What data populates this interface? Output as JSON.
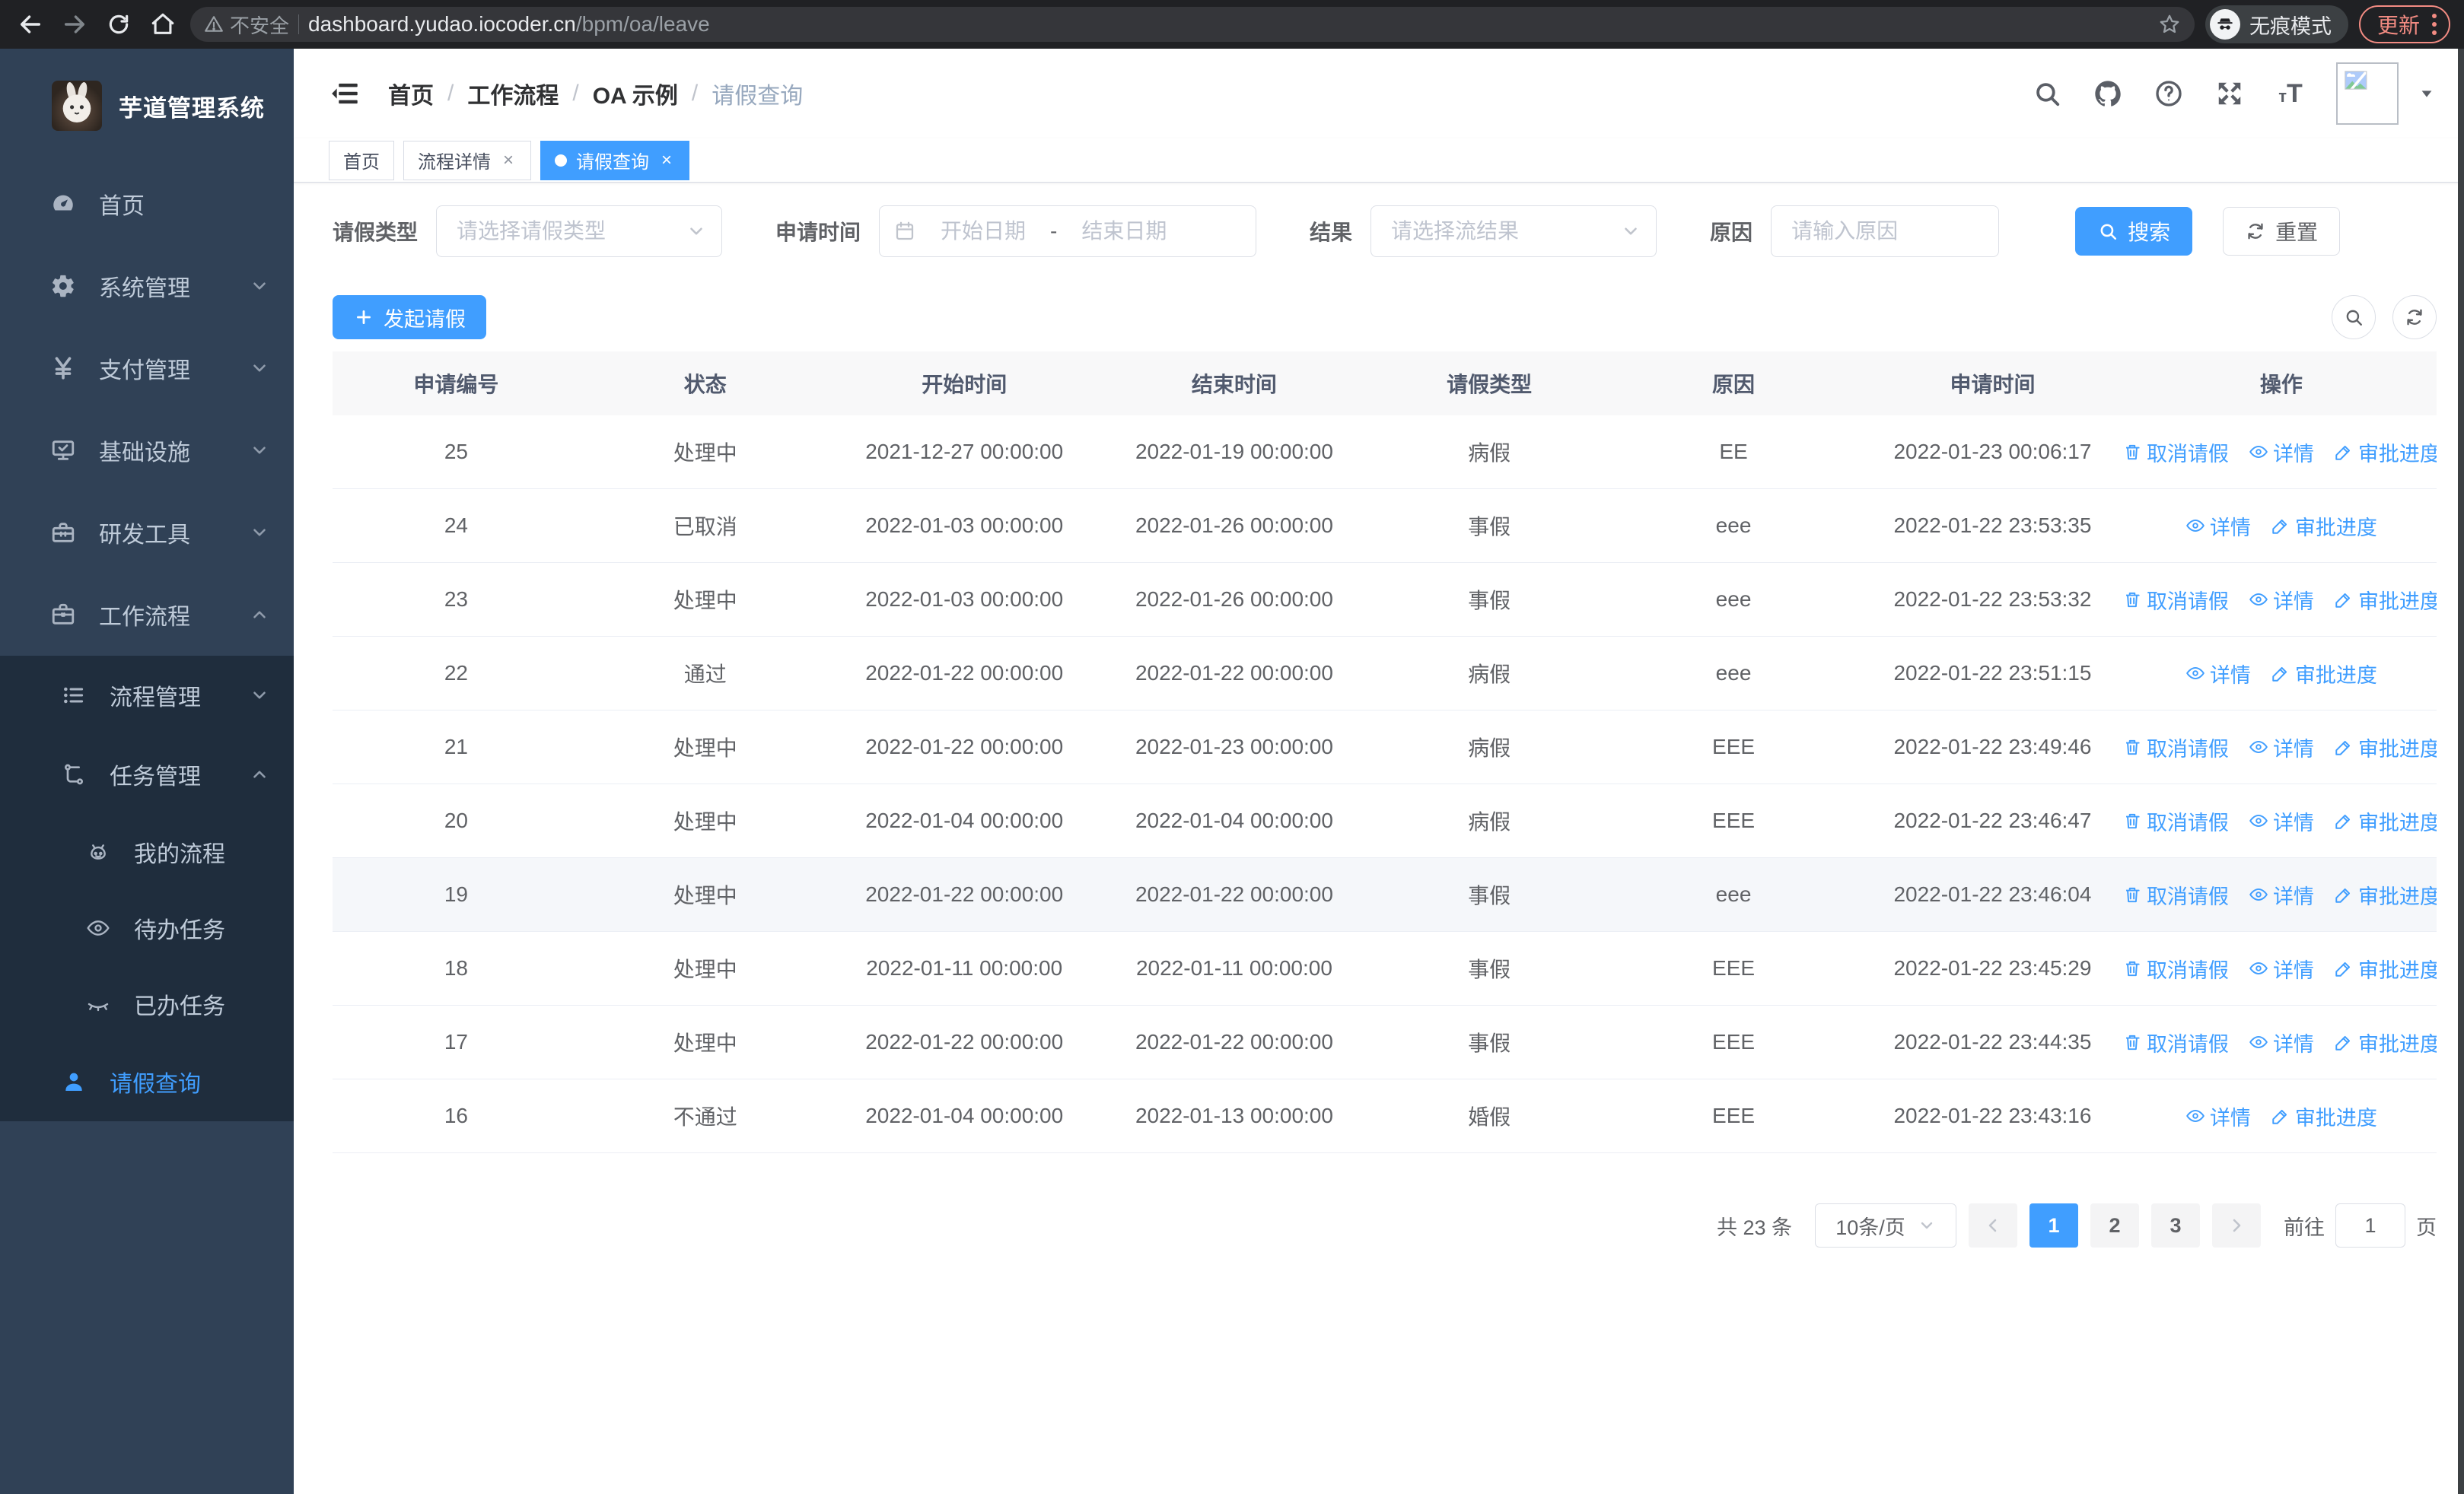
{
  "browser": {
    "security_label": "不安全",
    "url_host": "dashboard.yudao.iocoder.cn",
    "url_path": "/bpm/oa/leave",
    "incognito_label": "无痕模式",
    "update_label": "更新"
  },
  "sidebar": {
    "title": "芋道管理系统",
    "items": [
      {
        "label": "首页",
        "icon": "dashboard-icon"
      },
      {
        "label": "系统管理",
        "icon": "gear-icon",
        "chevron": "down"
      },
      {
        "label": "支付管理",
        "icon": "yen-icon",
        "chevron": "down"
      },
      {
        "label": "基础设施",
        "icon": "monitor-icon",
        "chevron": "down"
      },
      {
        "label": "研发工具",
        "icon": "toolbox-icon",
        "chevron": "down"
      },
      {
        "label": "工作流程",
        "icon": "briefcase-icon",
        "chevron": "up"
      },
      {
        "label": "流程管理",
        "icon": "list-icon",
        "chevron": "down"
      },
      {
        "label": "任务管理",
        "icon": "flow-icon",
        "chevron": "up"
      },
      {
        "label": "我的流程",
        "icon": "robot-icon"
      },
      {
        "label": "待办任务",
        "icon": "eye-icon"
      },
      {
        "label": "已办任务",
        "icon": "eye-closed-icon"
      },
      {
        "label": "请假查询",
        "icon": "user-icon",
        "active": true
      }
    ]
  },
  "breadcrumb": {
    "items": [
      "首页",
      "工作流程",
      "OA 示例",
      "请假查询"
    ]
  },
  "tabs": [
    {
      "label": "首页",
      "closable": false,
      "active": false
    },
    {
      "label": "流程详情",
      "closable": true,
      "active": false
    },
    {
      "label": "请假查询",
      "closable": true,
      "active": true
    }
  ],
  "filters": {
    "leave_type": {
      "label": "请假类型",
      "placeholder": "请选择请假类型"
    },
    "apply_time": {
      "label": "申请时间",
      "start_placeholder": "开始日期",
      "separator": "-",
      "end_placeholder": "结束日期"
    },
    "result": {
      "label": "结果",
      "placeholder": "请选择流结果"
    },
    "reason": {
      "label": "原因",
      "placeholder": "请输入原因"
    },
    "search_label": "搜索",
    "reset_label": "重置"
  },
  "toolbar": {
    "create_label": "发起请假"
  },
  "table": {
    "columns": [
      "申请编号",
      "状态",
      "开始时间",
      "结束时间",
      "请假类型",
      "原因",
      "申请时间",
      "操作"
    ],
    "action_labels": {
      "cancel": "取消请假",
      "detail": "详情",
      "progress": "审批进度"
    },
    "rows": [
      {
        "id": "25",
        "status": "处理中",
        "start_time": "2021-12-27 00:00:00",
        "end_time": "2022-01-19 00:00:00",
        "leave_type": "病假",
        "reason": "EE",
        "apply_time": "2022-01-23 00:06:17",
        "actions": [
          "cancel",
          "detail",
          "progress"
        ]
      },
      {
        "id": "24",
        "status": "已取消",
        "start_time": "2022-01-03 00:00:00",
        "end_time": "2022-01-26 00:00:00",
        "leave_type": "事假",
        "reason": "eee",
        "apply_time": "2022-01-22 23:53:35",
        "actions": [
          "detail",
          "progress"
        ]
      },
      {
        "id": "23",
        "status": "处理中",
        "start_time": "2022-01-03 00:00:00",
        "end_time": "2022-01-26 00:00:00",
        "leave_type": "事假",
        "reason": "eee",
        "apply_time": "2022-01-22 23:53:32",
        "actions": [
          "cancel",
          "detail",
          "progress"
        ]
      },
      {
        "id": "22",
        "status": "通过",
        "start_time": "2022-01-22 00:00:00",
        "end_time": "2022-01-22 00:00:00",
        "leave_type": "病假",
        "reason": "eee",
        "apply_time": "2022-01-22 23:51:15",
        "actions": [
          "detail",
          "progress"
        ]
      },
      {
        "id": "21",
        "status": "处理中",
        "start_time": "2022-01-22 00:00:00",
        "end_time": "2022-01-23 00:00:00",
        "leave_type": "病假",
        "reason": "EEE",
        "apply_time": "2022-01-22 23:49:46",
        "actions": [
          "cancel",
          "detail",
          "progress"
        ]
      },
      {
        "id": "20",
        "status": "处理中",
        "start_time": "2022-01-04 00:00:00",
        "end_time": "2022-01-04 00:00:00",
        "leave_type": "病假",
        "reason": "EEE",
        "apply_time": "2022-01-22 23:46:47",
        "actions": [
          "cancel",
          "detail",
          "progress"
        ]
      },
      {
        "id": "19",
        "status": "处理中",
        "start_time": "2022-01-22 00:00:00",
        "end_time": "2022-01-22 00:00:00",
        "leave_type": "事假",
        "reason": "eee",
        "apply_time": "2022-01-22 23:46:04",
        "actions": [
          "cancel",
          "detail",
          "progress"
        ],
        "highlighted": true
      },
      {
        "id": "18",
        "status": "处理中",
        "start_time": "2022-01-11 00:00:00",
        "end_time": "2022-01-11 00:00:00",
        "leave_type": "事假",
        "reason": "EEE",
        "apply_time": "2022-01-22 23:45:29",
        "actions": [
          "cancel",
          "detail",
          "progress"
        ]
      },
      {
        "id": "17",
        "status": "处理中",
        "start_time": "2022-01-22 00:00:00",
        "end_time": "2022-01-22 00:00:00",
        "leave_type": "事假",
        "reason": "EEE",
        "apply_time": "2022-01-22 23:44:35",
        "actions": [
          "cancel",
          "detail",
          "progress"
        ]
      },
      {
        "id": "16",
        "status": "不通过",
        "start_time": "2022-01-04 00:00:00",
        "end_time": "2022-01-13 00:00:00",
        "leave_type": "婚假",
        "reason": "EEE",
        "apply_time": "2022-01-22 23:43:16",
        "actions": [
          "detail",
          "progress"
        ]
      }
    ]
  },
  "pagination": {
    "total_label": "共 23 条",
    "page_size": "10条/页",
    "pages": [
      "1",
      "2",
      "3"
    ],
    "active_page": "1",
    "goto_label": "前往",
    "goto_value": "1",
    "unit_label": "页"
  },
  "colors": {
    "accent": "#409eff",
    "sidebar_bg": "#304156",
    "submenu_bg": "#1f2d3d",
    "chrome_bg": "#202124",
    "update_accent": "#f28b82",
    "table_header_bg": "#f8f8f9",
    "row_hover_bg": "#f5f7fa"
  }
}
